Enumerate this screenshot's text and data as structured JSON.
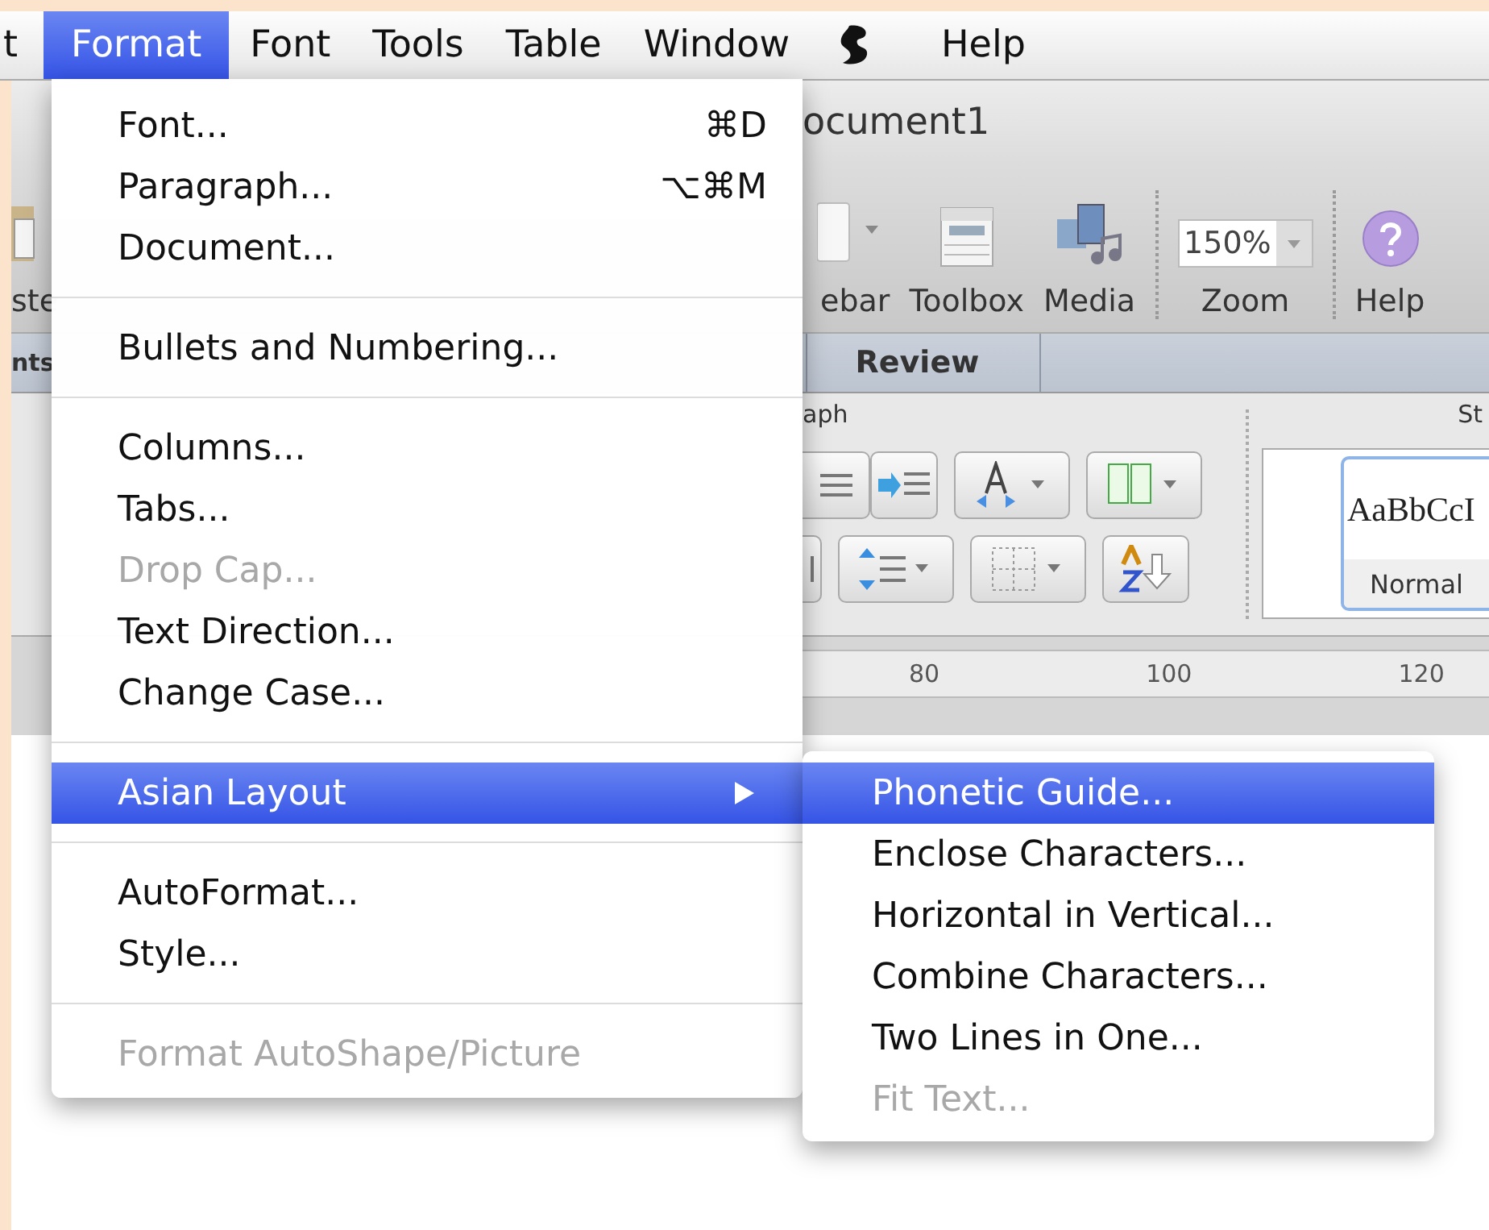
{
  "menu_bar": {
    "items": [
      {
        "kind": "text",
        "label": "t",
        "selected": false
      },
      {
        "kind": "text",
        "label": "Format",
        "selected": true
      },
      {
        "kind": "text",
        "label": "Font",
        "selected": false
      },
      {
        "kind": "text",
        "label": "Tools",
        "selected": false
      },
      {
        "kind": "text",
        "label": "Table",
        "selected": false
      },
      {
        "kind": "text",
        "label": "Window",
        "selected": false
      },
      {
        "kind": "icon",
        "selected": false
      },
      {
        "kind": "text",
        "label": "Help",
        "selected": false
      }
    ]
  },
  "document_window": {
    "title": "ocument1",
    "toolbar_left_label": "ste",
    "toolbar": [
      {
        "label": "ebar",
        "kind": "dropdown"
      },
      {
        "label": "Toolbox",
        "kind": "toolbox"
      },
      {
        "label": "Media",
        "kind": "media"
      }
    ],
    "zoom": {
      "value": "150%",
      "label": "Zoom"
    },
    "help": {
      "label": "Help"
    },
    "ribbon_tabs": [
      {
        "label": "nts"
      },
      {
        "label": "Review"
      }
    ],
    "ribbon_groups": [
      "aph",
      "St"
    ],
    "style_gallery": {
      "sample": "AaBbCcI",
      "name": "Normal"
    },
    "ruler": [
      "80",
      "100",
      "120"
    ]
  },
  "format_menu": {
    "groups": [
      [
        {
          "label": "Font...",
          "shortcut": "⌘D",
          "disabled": false,
          "selected": false,
          "submenu": false
        },
        {
          "label": "Paragraph...",
          "shortcut": "⌥⌘M",
          "disabled": false,
          "selected": false,
          "submenu": false
        },
        {
          "label": "Document...",
          "disabled": false,
          "selected": false,
          "submenu": false
        }
      ],
      [
        {
          "label": "Bullets and Numbering...",
          "disabled": false,
          "selected": false,
          "submenu": false
        }
      ],
      [
        {
          "label": "Columns...",
          "disabled": false,
          "selected": false,
          "submenu": false
        },
        {
          "label": "Tabs...",
          "disabled": false,
          "selected": false,
          "submenu": false
        },
        {
          "label": "Drop Cap...",
          "disabled": true,
          "selected": false,
          "submenu": false
        },
        {
          "label": "Text Direction...",
          "disabled": false,
          "selected": false,
          "submenu": false
        },
        {
          "label": "Change Case...",
          "disabled": false,
          "selected": false,
          "submenu": false
        }
      ],
      [
        {
          "label": "Asian Layout",
          "disabled": false,
          "selected": true,
          "submenu": true
        }
      ],
      [
        {
          "label": "AutoFormat...",
          "disabled": false,
          "selected": false,
          "submenu": false
        },
        {
          "label": "Style...",
          "disabled": false,
          "selected": false,
          "submenu": false
        }
      ],
      [
        {
          "label": "Format AutoShape/Picture",
          "disabled": true,
          "selected": false,
          "submenu": false
        }
      ]
    ]
  },
  "asian_layout_submenu": {
    "items": [
      {
        "label": "Phonetic Guide...",
        "disabled": false,
        "selected": true
      },
      {
        "label": "Enclose Characters...",
        "disabled": false,
        "selected": false
      },
      {
        "label": "Horizontal in Vertical...",
        "disabled": false,
        "selected": false
      },
      {
        "label": "Combine Characters...",
        "disabled": false,
        "selected": false
      },
      {
        "label": "Two Lines in One...",
        "disabled": false,
        "selected": false
      },
      {
        "label": "Fit Text...",
        "disabled": true,
        "selected": false
      }
    ]
  }
}
